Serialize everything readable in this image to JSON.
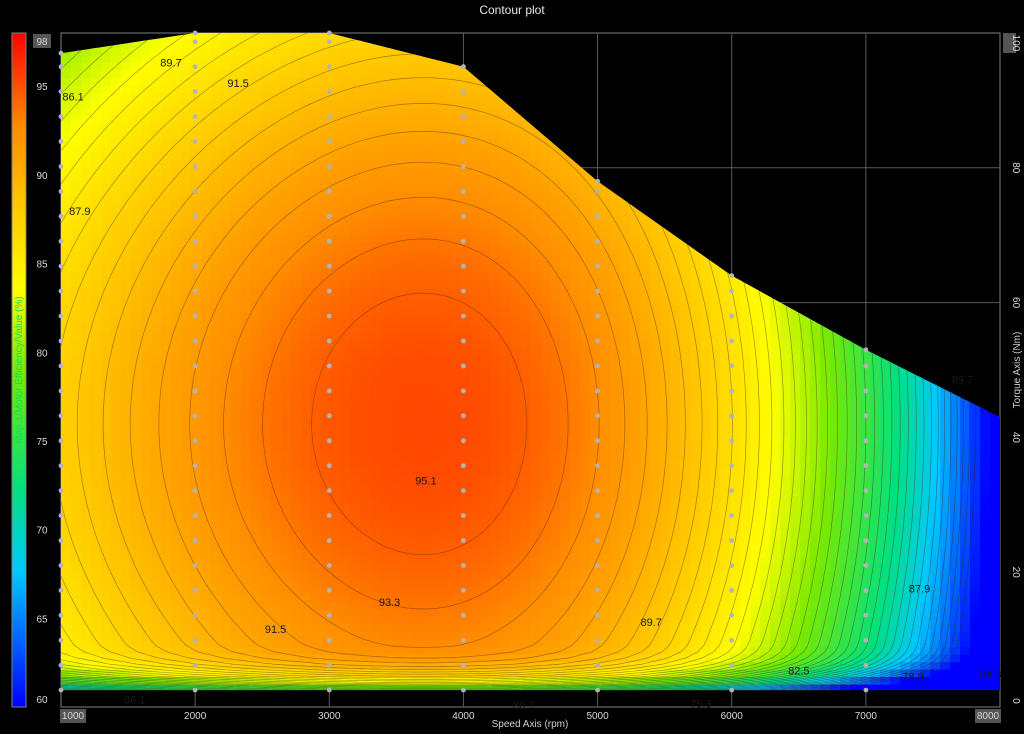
{
  "chart_data": {
    "type": "heatmap",
    "subtype": "contour",
    "title": "Contour plot",
    "xlabel": "Speed Axis (rpm)",
    "ylabel": "Torque Axis (Nm)",
    "colorbar_label": "Map.1/Motor Efficiency/Value (%)",
    "xlim": [
      1000,
      8000
    ],
    "ylim": [
      0,
      100
    ],
    "zlim": [
      60,
      98
    ],
    "x_ticks": [
      "1000",
      "2000",
      "3000",
      "4000",
      "5000",
      "6000",
      "7000",
      "8000"
    ],
    "y_ticks": [
      "0",
      "20",
      "40",
      "60",
      "80",
      "100"
    ],
    "colorbar_ticks": [
      "60",
      "65",
      "70",
      "75",
      "80",
      "85",
      "90",
      "95",
      "98"
    ],
    "grid": true,
    "colormap": [
      "#0000ff",
      "#00c8ff",
      "#00e080",
      "#7aea00",
      "#ffff00",
      "#ffc000",
      "#ff8c00",
      "#ff3c00",
      "#ff0000"
    ],
    "max_torque_envelope": [
      {
        "x": 1000,
        "y": 97
      },
      {
        "x": 2000,
        "y": 100
      },
      {
        "x": 3000,
        "y": 100
      },
      {
        "x": 4000,
        "y": 95
      },
      {
        "x": 5000,
        "y": 78
      },
      {
        "x": 6000,
        "y": 64
      },
      {
        "x": 7000,
        "y": 53
      },
      {
        "x": 8000,
        "y": 43
      }
    ],
    "peak": {
      "x": 3700,
      "y": 42,
      "z": 95.3
    },
    "measured_points": {
      "x": [
        1000,
        2000,
        3000,
        4000,
        5000,
        6000,
        7000
      ],
      "y_step": 3.7
    },
    "contour_labels": [
      {
        "text": "86.1",
        "x": 1090,
        "y": 90
      },
      {
        "text": "87.9",
        "x": 1140,
        "y": 73
      },
      {
        "text": "89.7",
        "x": 1820,
        "y": 95
      },
      {
        "text": "91.5",
        "x": 2320,
        "y": 92
      },
      {
        "text": "95.1",
        "x": 3720,
        "y": 33
      },
      {
        "text": "93.3",
        "x": 3450,
        "y": 15
      },
      {
        "text": "91.5",
        "x": 2600,
        "y": 11
      },
      {
        "text": "89.7",
        "x": 5400,
        "y": 12
      },
      {
        "text": "87.9",
        "x": 7400,
        "y": 17
      },
      {
        "text": "86.1",
        "x": 1550,
        "y": 0.5
      },
      {
        "text": "80.7",
        "x": 4450,
        "y": -0.3
      },
      {
        "text": "75.3",
        "x": 5770,
        "y": -0.1
      },
      {
        "text": "82.5",
        "x": 6500,
        "y": 4.8
      },
      {
        "text": "78.9",
        "x": 7350,
        "y": 3.9
      },
      {
        "text": "84.3",
        "x": 7930,
        "y": 4.3
      },
      {
        "text": "89.7",
        "x": 7720,
        "y": 48
      }
    ]
  }
}
